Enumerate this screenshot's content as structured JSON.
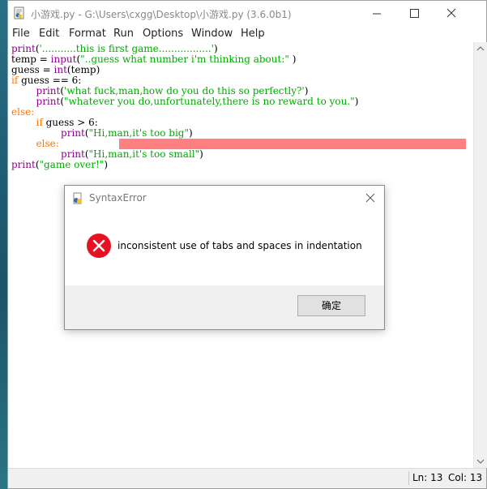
{
  "window": {
    "title": "小游戏.py - G:\\Users\\cxgg\\Desktop\\小游戏.py (3.6.0b1)"
  },
  "menu": [
    "File",
    "Edit",
    "Format",
    "Run",
    "Options",
    "Window",
    "Help"
  ],
  "code": {
    "line1": {
      "fn": "print",
      "p1": "(",
      "str": "'...........this is first game.................'",
      "p2": ")"
    },
    "line2": {
      "a": "temp = ",
      "fn": "input",
      "p1": "(",
      "str": "\"..guess what number i'm thinking about:\"",
      "p2": " )"
    },
    "line3": {
      "a": "guess = ",
      "fn": "int",
      "b": "(temp)"
    },
    "line4": {
      "kw": "if",
      "a": " guess == 6:"
    },
    "line5": {
      "indent": "        ",
      "fn": "print",
      "p1": "(",
      "str": "'what fuck,man,how do you do this so perfectly?'",
      "p2": ")"
    },
    "line6": {
      "indent": "        ",
      "fn": "print",
      "p1": "(",
      "str": "\"whatever you do,unfortunately,there is no reward to you.\"",
      "p2": ")"
    },
    "line7": {
      "kw": "else:"
    },
    "line8": {
      "indent": "        ",
      "kw": "if",
      "a": " guess > 6:"
    },
    "line9": {
      "indent": "                ",
      "fn": "print",
      "p1": "(",
      "str": "\"Hi,man,it's too big\"",
      "p2": ")"
    },
    "line10": {
      "indent": "        ",
      "kw": "else:"
    },
    "line11": {
      "indent": "                ",
      "fn": "print",
      "p1": "(",
      "str": "\"Hi,man,it's too small\"",
      "p2": ")"
    },
    "line12": {
      "fn": "print",
      "p1": "(",
      "str": "\"game over!\"",
      "p2": ")"
    }
  },
  "status": {
    "line": "Ln: 13",
    "col": "Col: 13"
  },
  "dialog": {
    "title": "SyntaxError",
    "message": "inconsistent use of tabs and spaces in indentation",
    "ok_label": "确定"
  },
  "colors": {
    "keyword": "#ff7700",
    "builtin": "#900090",
    "string": "#00aa00",
    "error_highlight": "#ff8080",
    "error_icon": "#e81123"
  }
}
